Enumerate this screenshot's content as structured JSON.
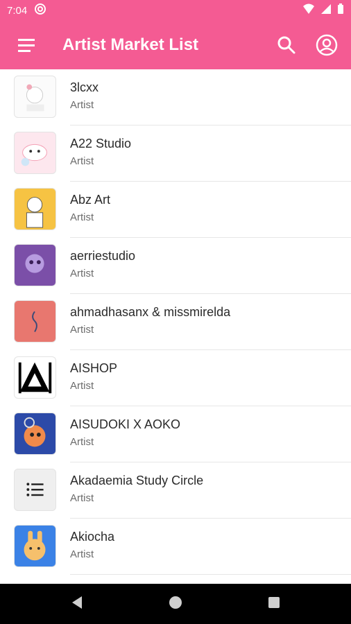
{
  "status_bar": {
    "time": "7:04",
    "icons": [
      "at-sign-icon",
      "wifi-icon",
      "signal-icon",
      "battery-icon"
    ]
  },
  "app_bar": {
    "title": "Artist Market List",
    "accent_color": "#f45b93"
  },
  "artists": [
    {
      "name": "3lcxx",
      "role": "Artist"
    },
    {
      "name": "A22 Studio",
      "role": "Artist"
    },
    {
      "name": "Abz Art",
      "role": "Artist"
    },
    {
      "name": "aerriestudio",
      "role": "Artist"
    },
    {
      "name": "ahmadhasanx & missmirelda",
      "role": "Artist"
    },
    {
      "name": "AISHOP",
      "role": "Artist"
    },
    {
      "name": "AISUDOKI X AOKO",
      "role": "Artist"
    },
    {
      "name": "Akadaemia Study Circle",
      "role": "Artist"
    },
    {
      "name": "Akiocha",
      "role": "Artist"
    }
  ],
  "nav_bar": {
    "icons": [
      "back-icon",
      "home-icon",
      "recents-icon"
    ]
  }
}
